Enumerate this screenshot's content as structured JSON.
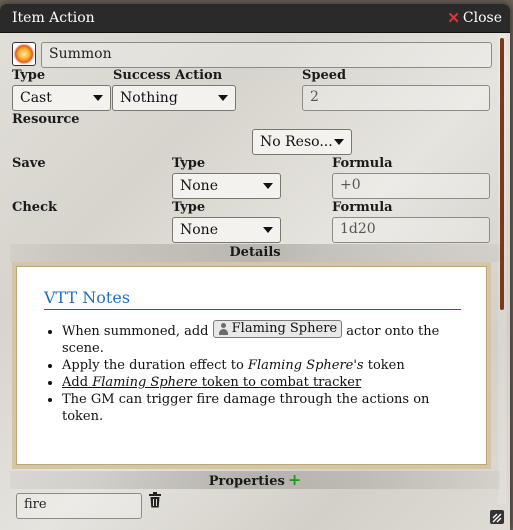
{
  "window": {
    "title": "Item Action",
    "close_label": "Close"
  },
  "name_field": {
    "value": "Summon",
    "icon": "flaming-sphere-icon"
  },
  "labels": {
    "type": "Type",
    "success_action": "Success Action",
    "speed": "Speed",
    "resource": "Resource",
    "save": "Save",
    "save_type": "Type",
    "save_formula": "Formula",
    "check": "Check",
    "check_type": "Type",
    "check_formula": "Formula"
  },
  "fields": {
    "type_value": "Cast",
    "success_action_value": "Nothing",
    "speed_value": "2",
    "resource_value": "No Reso...",
    "save_type_value": "None",
    "save_formula_value": "+0",
    "check_type_value": "None",
    "check_formula_value": "1d20"
  },
  "details": {
    "header": "Details",
    "notes_title": "VTT Notes",
    "line1_before": "When summoned, add",
    "actor_chip": "Flaming Sphere",
    "line1_after": "actor onto the scene.",
    "line2_before": "Apply the duration effect to",
    "line2_em": "Flaming Sphere's",
    "line2_after": "token",
    "line3_before": "Add",
    "line3_em": "Flaming Sphere",
    "line3_after": "token to combat tracker",
    "line4": "The GM can trigger fire damage through the actions on token."
  },
  "properties": {
    "header": "Properties",
    "items": [
      "fire"
    ]
  },
  "colors": {
    "accent_link": "#1f6fbf",
    "close_x": "#e53333",
    "add_plus": "#1c9a1c",
    "scroll_thumb": "#7c3818"
  }
}
